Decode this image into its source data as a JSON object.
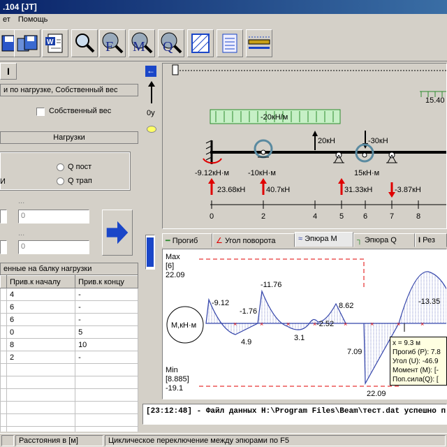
{
  "window": {
    "title": ".104 [JT]"
  },
  "menu": {
    "items": [
      "ет",
      "Помощь"
    ]
  },
  "toolbar": {
    "buttons": [
      "floppy-icon",
      "save-all-icon",
      "word-icon",
      "zoom-icon",
      "f-icon",
      "m-icon",
      "q-icon",
      "hatch-icon",
      "list-icon",
      "beam-icon"
    ],
    "f": "F",
    "m": "M",
    "q": "Q"
  },
  "left": {
    "tab_symbol": "I",
    "header1": "и по нагрузке, Собственный вес",
    "self_weight_label": "Собственный вес",
    "loads_header": "Нагрузки",
    "radio_q_const": "Q пост",
    "radio_q_trap": "Q трап",
    "partial_char": "И",
    "dots1": "...",
    "dots2": "...",
    "field1": "0",
    "field2": "0",
    "field3": "0",
    "applied_header": "енные на балку нагрузки",
    "col_start": "Прив.к началу",
    "col_end": "Прив.к концу",
    "rows": [
      {
        "a": "4",
        "b": "-"
      },
      {
        "a": "6",
        "b": "-"
      },
      {
        "a": "6",
        "b": "-"
      },
      {
        "a": "0",
        "b": "5"
      },
      {
        "a": "8",
        "b": "10"
      },
      {
        "a": "2",
        "b": "-"
      },
      {
        "a": "",
        "b": ""
      },
      {
        "a": "",
        "b": ""
      },
      {
        "a": "",
        "b": ""
      },
      {
        "a": "",
        "b": ""
      },
      {
        "a": "",
        "b": ""
      },
      {
        "a": "",
        "b": ""
      }
    ]
  },
  "beam": {
    "axis_label": "0y",
    "distributed": "-20кН/м",
    "right_distributed": "15.40",
    "point_20": "20кН",
    "point_30": "-30кН",
    "moment_left": "-9.12кН·м",
    "moment_10": "-10кН·м",
    "moment_15": "15кН·м",
    "reactions": [
      "23.68кН",
      "40.7кН",
      "31.33кН",
      "-3.87кН"
    ],
    "ticks": [
      "0",
      "2",
      "4",
      "5",
      "6",
      "7",
      "8"
    ]
  },
  "tabs": [
    "Прогиб",
    "Угол поворота",
    "Эпюра M",
    "Эпюра Q",
    "Рез"
  ],
  "diagram": {
    "max_label": "Max",
    "max_pos": "[6]",
    "max_val": "22.09",
    "min_label": "Min",
    "min_pos": "[8.885]",
    "min_val": "-19.1",
    "circle_label": "M,кН·м",
    "values": [
      "-9.12",
      "-11.76",
      "-1.76",
      "4.9",
      "3.1",
      "-2.52",
      "8.62",
      "7.09",
      "22.09",
      "-13.35"
    ]
  },
  "tooltip": {
    "lines": [
      "x = 9.3 м",
      "Прогиб (P): 7.8",
      "Угол (U): -46.9",
      "Момент (M): [-",
      "Поп.сила(Q): ["
    ]
  },
  "log": "[23:12:48] - Файл данных H:\\Program Files\\Beam\\тест.dat успешно п",
  "status": {
    "cell1": "",
    "cell2": "Расстояния в [м]",
    "cell3": "Циклическое переключение между эпюрами по F5"
  },
  "colors": {
    "load_green": "#2e8b2e",
    "arrow_red": "#e00000",
    "diagram_blue": "#3344aa",
    "accent_blue": "#1a46c8"
  }
}
